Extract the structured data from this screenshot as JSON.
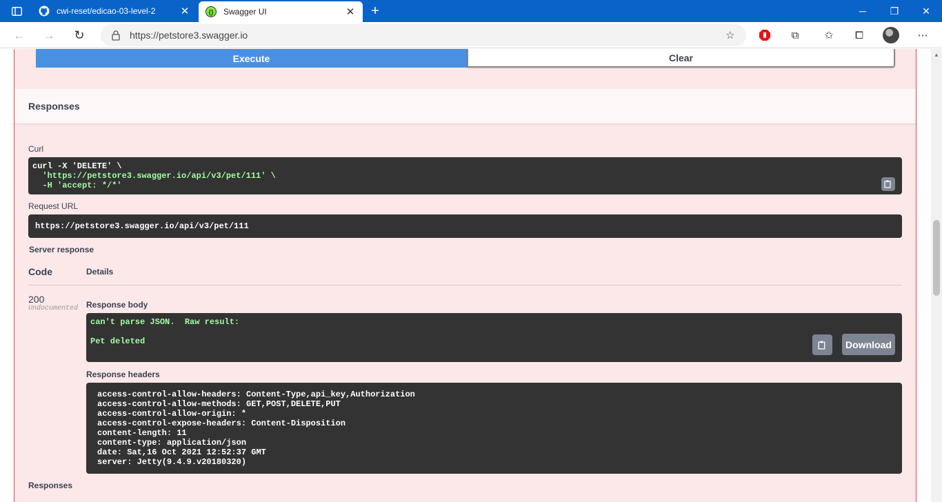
{
  "browser": {
    "tabs": [
      {
        "title": "cwi-reset/edicao-03-level-2",
        "active": false,
        "icon": "github-icon"
      },
      {
        "title": "Swagger UI",
        "active": true,
        "icon": "swagger-icon"
      }
    ],
    "new_tab": "+",
    "address": "https://petstore3.swagger.io",
    "accent_color": "#0a63c9"
  },
  "page": {
    "execute_label": "Execute",
    "clear_label": "Clear",
    "responses_title": "Responses",
    "curl_label": "Curl",
    "curl_lines": [
      "curl -X 'DELETE' \\",
      "  'https://petstore3.swagger.io/api/v3/pet/111' \\",
      "  -H 'accept: */*'"
    ],
    "request_url_label": "Request URL",
    "request_url": "https://petstore3.swagger.io/api/v3/pet/111",
    "server_response_label": "Server response",
    "code_header": "Code",
    "details_header": "Details",
    "response_code": "200",
    "response_code_note": "Undocumented",
    "response_body_label": "Response body",
    "response_body_line1": "can't parse JSON.  Raw result:",
    "response_body_line2": "Pet deleted",
    "download_label": "Download",
    "response_headers_label": "Response headers",
    "response_headers": [
      "access-control-allow-headers: Content-Type,api_key,Authorization",
      "access-control-allow-methods: GET,POST,DELETE,PUT",
      "access-control-allow-origin: *",
      "access-control-expose-headers: Content-Disposition",
      "content-length: 11",
      "content-type: application/json",
      "date: Sat,16 Oct 2021 12:52:37 GMT",
      "server: Jetty(9.4.9.v20180320)"
    ],
    "responses_footer": "Responses",
    "method_color": "#f93e3e",
    "execute_color": "#4990e2"
  }
}
